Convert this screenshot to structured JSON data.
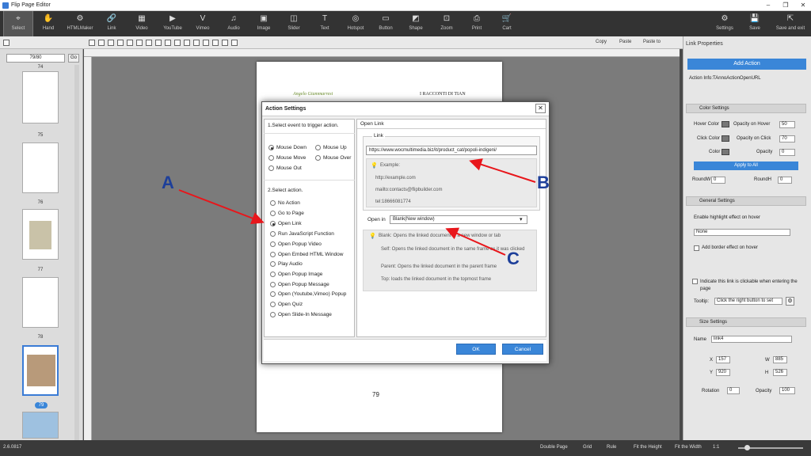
{
  "window": {
    "title": "Flip Page Editor",
    "controls": [
      "–",
      "❐",
      "✕"
    ]
  },
  "toolbar": {
    "tools": [
      {
        "label": "Select",
        "icon": "⌖"
      },
      {
        "label": "Hand",
        "icon": "✋"
      },
      {
        "label": "HTMLMaker",
        "icon": "⚙"
      },
      {
        "label": "Link",
        "icon": "🔗"
      },
      {
        "label": "Video",
        "icon": "▦"
      },
      {
        "label": "YouTube",
        "icon": "▶"
      },
      {
        "label": "Vimeo",
        "icon": "V"
      },
      {
        "label": "Audio",
        "icon": "♫"
      },
      {
        "label": "Image",
        "icon": "▣"
      },
      {
        "label": "Slider",
        "icon": "◫"
      },
      {
        "label": "Text",
        "icon": "T"
      },
      {
        "label": "Hotspot",
        "icon": "◎"
      },
      {
        "label": "Button",
        "icon": "▭"
      },
      {
        "label": "Shape",
        "icon": "◩"
      },
      {
        "label": "Zoom",
        "icon": "⊡"
      },
      {
        "label": "Print",
        "icon": "⎙"
      },
      {
        "label": "Cart",
        "icon": "🛒"
      }
    ],
    "right_tools": [
      {
        "label": "Settings",
        "icon": "⚙"
      },
      {
        "label": "Save",
        "icon": "💾"
      },
      {
        "label": "Save and exit",
        "icon": "⇱"
      }
    ]
  },
  "subtoolbar": {
    "copy": "Copy",
    "paste": "Paste",
    "paste_to": "Paste to"
  },
  "left_panel": {
    "page_input": "79/80",
    "go": "Go",
    "thumbnails": [
      {
        "label": "74"
      },
      {
        "label": "75"
      },
      {
        "label": "76"
      },
      {
        "label": "77"
      },
      {
        "label": "78"
      },
      {
        "label": "79"
      }
    ]
  },
  "page": {
    "author": "Angelo Giammarresi",
    "book": "I RACCONTI DI TIAN",
    "number": "79"
  },
  "dialog": {
    "title": "Action Settings",
    "close": "✕",
    "section1": "1.Select event to trigger action.",
    "events": [
      {
        "label": "Mouse Down",
        "selected": true
      },
      {
        "label": "Mouse Up",
        "selected": false
      },
      {
        "label": "Mouse Move",
        "selected": false
      },
      {
        "label": "Mouse Over",
        "selected": false
      },
      {
        "label": "Mouse Out",
        "selected": false
      }
    ],
    "section2": "2.Select action.",
    "actions": [
      {
        "label": "No Action",
        "selected": false
      },
      {
        "label": "Go to Page",
        "selected": false
      },
      {
        "label": "Open Link",
        "selected": true
      },
      {
        "label": "Run JavaScript Function",
        "selected": false
      },
      {
        "label": "Open Popup Video",
        "selected": false
      },
      {
        "label": "Open Embed HTML Window",
        "selected": false
      },
      {
        "label": "Play Audio",
        "selected": false
      },
      {
        "label": "Open Popup Image",
        "selected": false
      },
      {
        "label": "Open Popup Message",
        "selected": false
      },
      {
        "label": "Open (Youtube,Vimeo) Popup",
        "selected": false
      },
      {
        "label": "Open Quiz",
        "selected": false
      },
      {
        "label": "Open Slide-In Message",
        "selected": false
      }
    ],
    "right_header": "Open Link",
    "link_group_label": "Link",
    "url": "https://www.wocmultimedia.biz/it/product_cat/popoli-indigeni/",
    "example_title": "Example:",
    "examples": [
      "http://example.com",
      "mailto:contacts@flipbuilder.com",
      "tel:18666081774"
    ],
    "open_in_label": "Open in",
    "open_in_value": "Blank(New window)",
    "target_help": [
      "Blank: Opens the linked document in a new window or tab",
      "Self: Opens the linked document in the same frame as it was clicked",
      "Parent: Opens the linked document in the parent frame",
      "Top: loads the linked document in the topmost frame"
    ],
    "ok": "OK",
    "cancel": "Cancel"
  },
  "right_panel": {
    "title": "Link Properties",
    "add_action": "Add Action",
    "action_info": "Action Info:TAnnoActionOpenURL",
    "color_settings": "Color Settings",
    "hover_color": "Hover Color",
    "opacity_on_hover": "Opacity on Hover",
    "opacity_on_hover_val": "50",
    "click_color": "Click Color",
    "opacity_on_click": "Opacity on Click",
    "opacity_on_click_val": "70",
    "color": "Color",
    "opacity": "Opacity",
    "opacity_val": "0",
    "apply_all": "Apply to All",
    "roundw": "RoundW",
    "roundw_val": "0",
    "roundh": "RoundH",
    "roundh_val": "0",
    "general_settings": "General Settings",
    "enable_highlight": "Enable highlight effect on hover",
    "highlight_value": "None",
    "add_border": "Add border effect on hover",
    "indicate_clickable": "Indicate this link is clickable when entering the page",
    "tooltip_label": "Tooltip:",
    "tooltip_value": "Click the right button to set",
    "size_settings": "Size Settings",
    "name_label": "Name",
    "name_value": "link4",
    "x_label": "X",
    "x_val": "157",
    "y_label": "Y",
    "y_val": "920",
    "w_label": "W",
    "w_val": "885",
    "h_label": "H",
    "h_val": "526",
    "rotation_label": "Rotation",
    "rotation_val": "0",
    "opacity2_label": "Opacity",
    "opacity2_val": "100"
  },
  "statusbar": {
    "version": "2.6.0817",
    "double_page": "Double Page",
    "grid": "Grid",
    "rule": "Rule",
    "fit_height": "Fit the Height",
    "fit_width": "Fit the Width",
    "ratio": "1:1"
  },
  "annotations": {
    "a": "A",
    "b": "B",
    "c": "C",
    "arrow_color": "#e8161b",
    "text_color": "#1d3f9a"
  }
}
